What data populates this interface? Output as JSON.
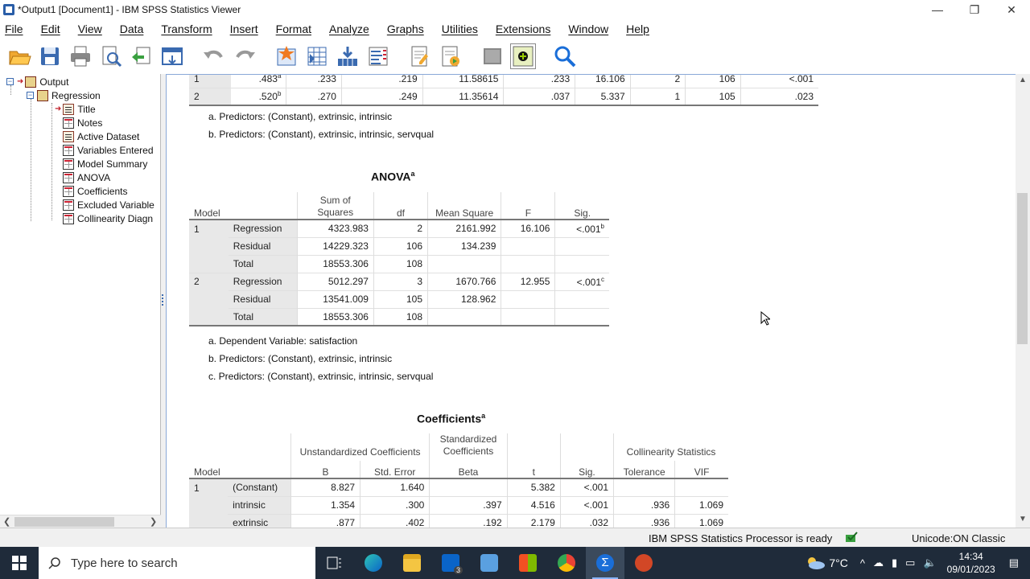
{
  "window": {
    "title": "*Output1 [Document1] - IBM SPSS Statistics Viewer",
    "minimize": "—",
    "restore": "❐",
    "close": "✕"
  },
  "menu": [
    "File",
    "Edit",
    "View",
    "Data",
    "Transform",
    "Insert",
    "Format",
    "Analyze",
    "Graphs",
    "Utilities",
    "Extensions",
    "Window",
    "Help"
  ],
  "toolbar_icons": [
    "open-icon",
    "save-icon",
    "print-icon",
    "print-preview-icon",
    "export-icon",
    "recall-dialog-icon",
    "undo-icon",
    "redo-icon",
    "goto-data-icon",
    "goto-case-icon",
    "goto-variable-icon",
    "variables-icon",
    "insert-output-icon",
    "designate-window-icon",
    "hide-icon",
    "new-output-icon",
    "search-icon"
  ],
  "outline": {
    "items": [
      {
        "label": "Output",
        "expander": "−"
      },
      {
        "label": "Regression",
        "expander": "−"
      },
      {
        "label": "Title"
      },
      {
        "label": "Notes"
      },
      {
        "label": "Active Dataset"
      },
      {
        "label": "Variables Entered"
      },
      {
        "label": "Model Summary"
      },
      {
        "label": "ANOVA"
      },
      {
        "label": "Coefficients"
      },
      {
        "label": "Excluded Variable"
      },
      {
        "label": "Collinearity Diagn"
      }
    ]
  },
  "model_summary": {
    "rows": [
      {
        "model": "1",
        "r": ".483",
        "r_sup": "a",
        "r2": ".233",
        "adj_r2": ".219",
        "se": "11.58615",
        "r2_change": ".233",
        "f_change": "16.106",
        "df1": "2",
        "df2": "106",
        "sig_f_change": "<.001"
      },
      {
        "model": "2",
        "r": ".520",
        "r_sup": "b",
        "r2": ".270",
        "adj_r2": ".249",
        "se": "11.35614",
        "r2_change": ".037",
        "f_change": "5.337",
        "df1": "1",
        "df2": "105",
        "sig_f_change": ".023"
      }
    ],
    "footnotes": [
      "a. Predictors: (Constant), extrinsic, intrinsic",
      "b. Predictors: (Constant), extrinsic, intrinsic, servqual"
    ]
  },
  "anova": {
    "title": "ANOVA",
    "title_sup": "a",
    "headers": {
      "model": "Model",
      "ss_line1": "Sum of",
      "ss_line2": "Squares",
      "df": "df",
      "ms": "Mean Square",
      "f": "F",
      "sig": "Sig."
    },
    "rows": [
      {
        "model": "1",
        "source": "Regression",
        "ss": "4323.983",
        "df": "2",
        "ms": "2161.992",
        "f": "16.106",
        "sig": "<.001",
        "sig_sup": "b"
      },
      {
        "model": "",
        "source": "Residual",
        "ss": "14229.323",
        "df": "106",
        "ms": "134.239",
        "f": "",
        "sig": "",
        "sig_sup": ""
      },
      {
        "model": "",
        "source": "Total",
        "ss": "18553.306",
        "df": "108",
        "ms": "",
        "f": "",
        "sig": "",
        "sig_sup": ""
      },
      {
        "model": "2",
        "source": "Regression",
        "ss": "5012.297",
        "df": "3",
        "ms": "1670.766",
        "f": "12.955",
        "sig": "<.001",
        "sig_sup": "c"
      },
      {
        "model": "",
        "source": "Residual",
        "ss": "13541.009",
        "df": "105",
        "ms": "128.962",
        "f": "",
        "sig": "",
        "sig_sup": ""
      },
      {
        "model": "",
        "source": "Total",
        "ss": "18553.306",
        "df": "108",
        "ms": "",
        "f": "",
        "sig": "",
        "sig_sup": ""
      }
    ],
    "footnotes": [
      "a. Dependent Variable: satisfaction",
      "b. Predictors: (Constant), extrinsic, intrinsic",
      "c. Predictors: (Constant), extrinsic, intrinsic, servqual"
    ]
  },
  "coefficients": {
    "title": "Coefficients",
    "title_sup": "a",
    "headers": {
      "unstd": "Unstandardized Coefficients",
      "std_line1": "Standardized",
      "std_line2": "Coefficients",
      "collin": "Collinearity Statistics",
      "model": "Model",
      "b": "B",
      "se": "Std. Error",
      "beta": "Beta",
      "t": "t",
      "sig": "Sig.",
      "tol": "Tolerance",
      "vif": "VIF"
    },
    "rows": [
      {
        "model": "1",
        "term": "(Constant)",
        "b": "8.827",
        "se": "1.640",
        "beta": "",
        "t": "5.382",
        "sig": "<.001",
        "tol": "",
        "vif": ""
      },
      {
        "model": "",
        "term": "intrinsic",
        "b": "1.354",
        "se": ".300",
        "beta": ".397",
        "t": "4.516",
        "sig": "<.001",
        "tol": ".936",
        "vif": "1.069"
      },
      {
        "model": "",
        "term": "extrinsic",
        "b": ".877",
        "se": ".402",
        "beta": ".192",
        "t": "2.179",
        "sig": ".032",
        "tol": ".936",
        "vif": "1.069"
      }
    ]
  },
  "status": {
    "processor": "IBM SPSS Statistics Processor is ready",
    "unicode": "Unicode:ON  Classic"
  },
  "taskbar": {
    "search_placeholder": "Type here to search",
    "mail_badge": "3",
    "weather": "7°C",
    "time": "14:34",
    "date": "09/01/2023"
  }
}
